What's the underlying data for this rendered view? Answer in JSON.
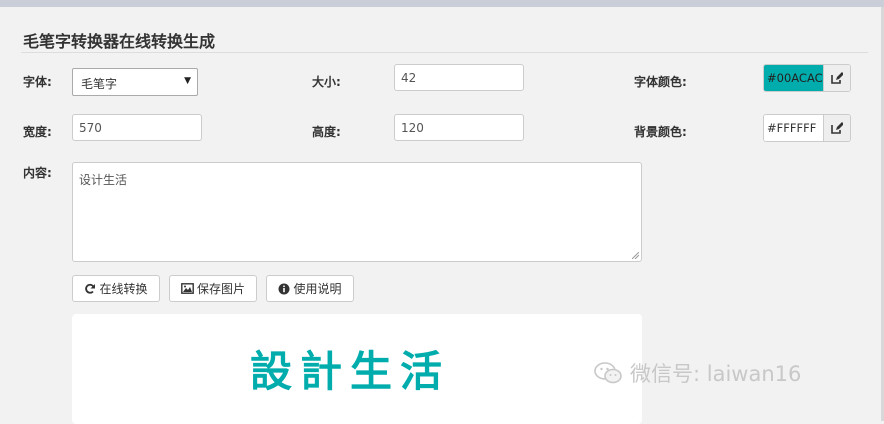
{
  "title": "毛笔字转换器在线转换生成",
  "form": {
    "font_label": "字体:",
    "font_value": "毛笔字",
    "size_label": "大小:",
    "size_value": "42",
    "font_color_label": "字体颜色:",
    "font_color_value": "#00ACAC",
    "width_label": "宽度:",
    "width_value": "570",
    "height_label": "高度:",
    "height_value": "120",
    "bg_color_label": "背景颜色:",
    "bg_color_value": "#FFFFFF",
    "content_label": "内容:",
    "content_value": "设计生活"
  },
  "buttons": {
    "convert": "在线转换",
    "save": "保存图片",
    "help": "使用说明"
  },
  "preview": {
    "text": "設計生活",
    "color": "#00ACAC"
  },
  "watermark": {
    "text": "微信号: laiwan16"
  }
}
